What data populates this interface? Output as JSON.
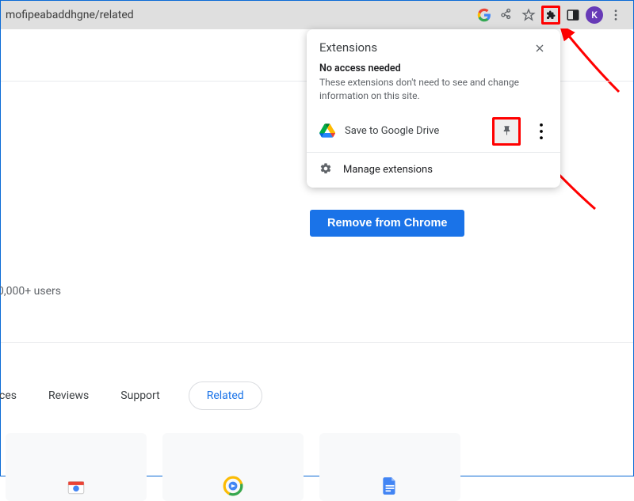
{
  "addressbar": {
    "url": "mofipeabaddhgne/related",
    "avatar_letter": "K"
  },
  "popup": {
    "title": "Extensions",
    "section_title": "No access needed",
    "section_desc": "These extensions don't need to see and change information on this site.",
    "ext_name": "Save to Google Drive",
    "manage_label": "Manage extensions"
  },
  "page": {
    "remove_label": "Remove from Chrome",
    "users": "0,000+ users",
    "tabs": {
      "practices": "tices",
      "reviews": "Reviews",
      "support": "Support",
      "related": "Related"
    }
  }
}
